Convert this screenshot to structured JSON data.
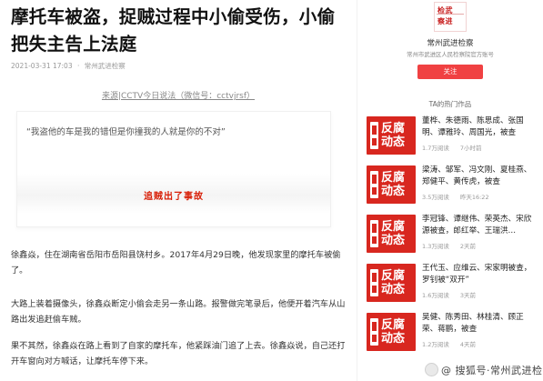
{
  "article": {
    "title": "摩托车被盗，捉贼过程中小偷受伤，小偷把失主告上法庭",
    "date": "2021-03-31 17:03",
    "author": "常州武进检察",
    "source": "来源|CCTV今日说法（微信号：cctvjrsf）",
    "video": {
      "quote": "“我盗他的车是我的错但是你撞我的人就是你的不对”",
      "caption": "追贼出了事故"
    },
    "paragraphs": [
      "徐鑫焱，住在湖南省岳阳市岳阳县饶村乡。2017年4月29日晚，他发现家里的摩托车被偷了。",
      "大路上装着摄像头，徐鑫焱断定小偷会走另一条山路。报警做完笔录后，他便开着汽车从山路出发追赶偷车贼。",
      "果不其然，徐鑫焱在路上看到了自家的摩托车，他紧踩油门追了上去。徐鑫焱说，自己还打开车窗向对方喊话，让摩托车停下来。"
    ]
  },
  "account": {
    "logo_line1": "检武",
    "logo_line2": "察进",
    "name": "常州武进检察",
    "desc": "常州市武进区人民检察院官方账号",
    "follow_label": "关注"
  },
  "hot": {
    "title": "TA的热门作品",
    "thumb_line1": "反腐",
    "thumb_line2": "动态",
    "items": [
      {
        "title": "董桦、朱德雨、陈思成、张国明、谭雅玲、周国光，被查",
        "reads": "1.7万阅读",
        "time": "7小时前"
      },
      {
        "title": "梁涛、邹军、冯文刚、夏桂燕、郑健平、黄传虎，被查",
        "reads": "3.5万阅读",
        "time": "昨天16:22"
      },
      {
        "title": "李冠锋、谭继伟、荣英杰、宋欣源被查，郎红举、王瑞洪…",
        "reads": "1.3万阅读",
        "time": "2天前"
      },
      {
        "title": "王代玉、应维云、宋家明被查，罗钊被“双开”",
        "reads": "1.6万阅读",
        "time": "3天前"
      },
      {
        "title": "吴健、陈秀田、林桂清、顾正荣、蒋鹏，被查",
        "reads": "1.2万阅读",
        "time": "4天前"
      }
    ]
  },
  "watermark": {
    "text": "@ 搜狐号·常州武进检察"
  }
}
